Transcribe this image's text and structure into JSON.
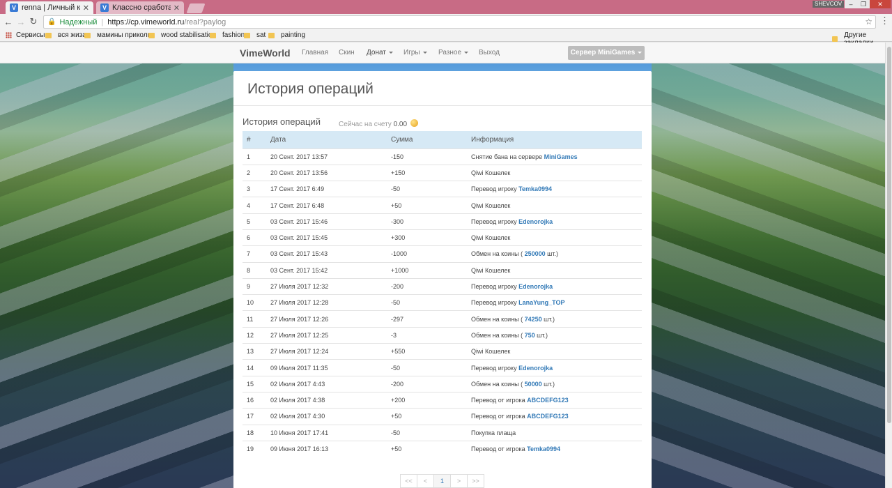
{
  "browser": {
    "tabs": [
      {
        "title": "renna | Личный кабинет",
        "active": true
      },
      {
        "title": "Классно сработано, кл",
        "active": false
      }
    ],
    "window_user": "SHEVCOV",
    "omnibox": {
      "secure_label": "Надежный",
      "url_host": "https://cp.vimeworld.ru",
      "url_path": "/real?paylog"
    },
    "bookmarks": [
      "Сервисы",
      "вся жиза",
      "мамины приколы",
      "wood stabilisation",
      "fashion",
      "sat",
      "painting"
    ],
    "other_bookmarks": "Другие закладки"
  },
  "navbar": {
    "brand": "VimeWorld",
    "items": [
      {
        "label": "Главная",
        "dropdown": false
      },
      {
        "label": "Скин",
        "dropdown": false
      },
      {
        "label": "Донат",
        "dropdown": true
      },
      {
        "label": "Игры",
        "dropdown": true
      },
      {
        "label": "Разное",
        "dropdown": true
      },
      {
        "label": "Выход",
        "dropdown": false
      }
    ],
    "server_button": "Сервер MiniGames"
  },
  "main": {
    "title": "История операций",
    "subtitle": "История операций",
    "balance_label": "Сейчас на счету",
    "balance_value": "0.00",
    "columns": [
      "#",
      "Дата",
      "Сумма",
      "Информация"
    ],
    "rows": [
      {
        "n": "1",
        "date": "20 Сент. 2017 13:57",
        "amount": "-150",
        "info": "Снятие бана на сервере",
        "highlight": "MiniGames",
        "suffix": ""
      },
      {
        "n": "2",
        "date": "20 Сент. 2017 13:56",
        "amount": "+150",
        "info": "Qiwi Кошелек",
        "highlight": "",
        "suffix": ""
      },
      {
        "n": "3",
        "date": "17 Сент. 2017 6:49",
        "amount": "-50",
        "info": "Перевод игроку",
        "highlight": "Temka0994",
        "suffix": ""
      },
      {
        "n": "4",
        "date": "17 Сент. 2017 6:48",
        "amount": "+50",
        "info": "Qiwi Кошелек",
        "highlight": "",
        "suffix": ""
      },
      {
        "n": "5",
        "date": "03 Сент. 2017 15:46",
        "amount": "-300",
        "info": "Перевод игроку",
        "highlight": "Edenorojka",
        "suffix": ""
      },
      {
        "n": "6",
        "date": "03 Сент. 2017 15:45",
        "amount": "+300",
        "info": "Qiwi Кошелек",
        "highlight": "",
        "suffix": ""
      },
      {
        "n": "7",
        "date": "03 Сент. 2017 15:43",
        "amount": "-1000",
        "info": "Обмен на коины (",
        "highlight": "250000",
        "suffix": " шт.)"
      },
      {
        "n": "8",
        "date": "03 Сент. 2017 15:42",
        "amount": "+1000",
        "info": "Qiwi Кошелек",
        "highlight": "",
        "suffix": ""
      },
      {
        "n": "9",
        "date": "27 Июля 2017 12:32",
        "amount": "-200",
        "info": "Перевод игроку",
        "highlight": "Edenorojka",
        "suffix": ""
      },
      {
        "n": "10",
        "date": "27 Июля 2017 12:28",
        "amount": "-50",
        "info": "Перевод игроку",
        "highlight": "LanaYung_TOP",
        "suffix": ""
      },
      {
        "n": "11",
        "date": "27 Июля 2017 12:26",
        "amount": "-297",
        "info": "Обмен на коины (",
        "highlight": "74250",
        "suffix": " шт.)"
      },
      {
        "n": "12",
        "date": "27 Июля 2017 12:25",
        "amount": "-3",
        "info": "Обмен на коины (",
        "highlight": "750",
        "suffix": " шт.)"
      },
      {
        "n": "13",
        "date": "27 Июля 2017 12:24",
        "amount": "+550",
        "info": "Qiwi Кошелек",
        "highlight": "",
        "suffix": ""
      },
      {
        "n": "14",
        "date": "09 Июля 2017 11:35",
        "amount": "-50",
        "info": "Перевод игроку",
        "highlight": "Edenorojka",
        "suffix": ""
      },
      {
        "n": "15",
        "date": "02 Июля 2017 4:43",
        "amount": "-200",
        "info": "Обмен на коины (",
        "highlight": "50000",
        "suffix": " шт.)"
      },
      {
        "n": "16",
        "date": "02 Июля 2017 4:38",
        "amount": "+200",
        "info": "Перевод от игрока",
        "highlight": "ABCDEFG123",
        "suffix": ""
      },
      {
        "n": "17",
        "date": "02 Июля 2017 4:30",
        "amount": "+50",
        "info": "Перевод от игрока",
        "highlight": "ABCDEFG123",
        "suffix": ""
      },
      {
        "n": "18",
        "date": "10 Июня 2017 17:41",
        "amount": "-50",
        "info": "Покупка плаща",
        "highlight": "",
        "suffix": ""
      },
      {
        "n": "19",
        "date": "09 Июня 2017 16:13",
        "amount": "+50",
        "info": "Перевод от игрока",
        "highlight": "Temka0994",
        "suffix": ""
      }
    ],
    "pagination": [
      "<<",
      "<",
      "1",
      ">",
      ">>"
    ],
    "current_page": "1"
  },
  "colors": {
    "negative": "#b94a48",
    "positive": "#3c763d",
    "link": "#337ab7",
    "table_header": "#d6e9f5"
  }
}
